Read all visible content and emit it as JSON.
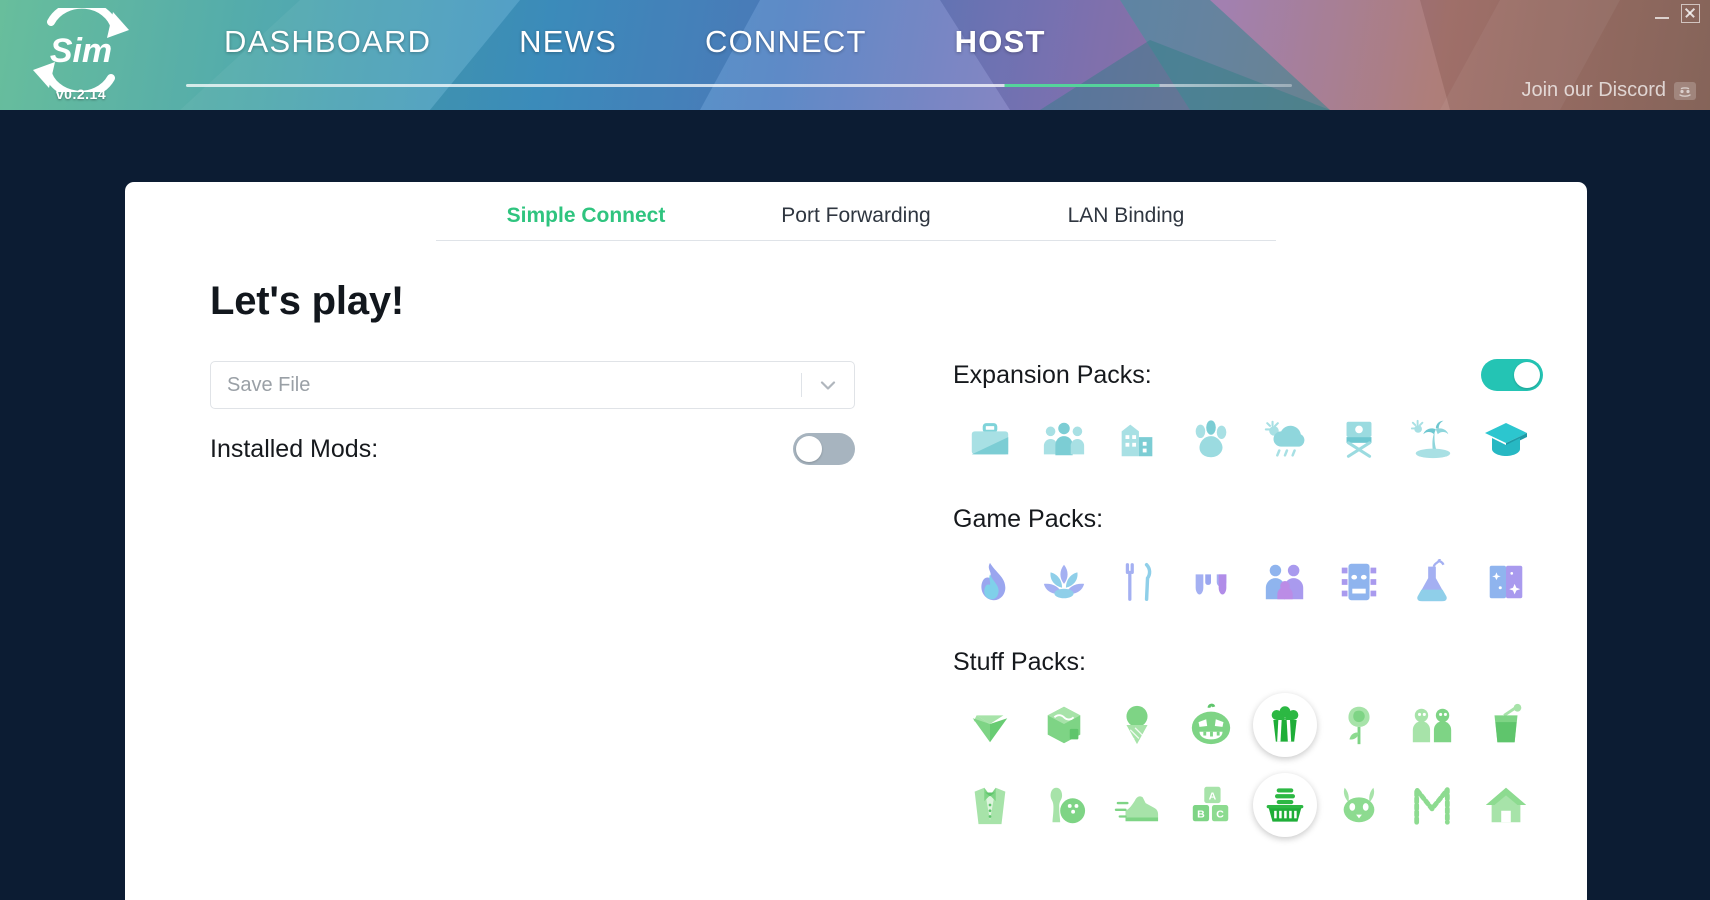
{
  "window": {
    "minimize_label": "minimize",
    "close_label": "close"
  },
  "header": {
    "logo_text": "Sim",
    "version": "v0.2.14",
    "nav": [
      {
        "label": "DASHBOARD",
        "active": false
      },
      {
        "label": "NEWS",
        "active": false
      },
      {
        "label": "CONNECT",
        "active": false
      },
      {
        "label": "HOST",
        "active": true
      }
    ],
    "discord_label": "Join our Discord",
    "accent_green": "#55d39b"
  },
  "tabs": [
    {
      "label": "Simple Connect",
      "active": true
    },
    {
      "label": "Port Forwarding",
      "active": false
    },
    {
      "label": "LAN Binding",
      "active": false
    }
  ],
  "main": {
    "title": "Let's play!",
    "save_file": {
      "placeholder": "Save File",
      "value": ""
    },
    "installed_mods": {
      "label": "Installed Mods:",
      "enabled": false
    }
  },
  "packs": {
    "expansion": {
      "label": "Expansion Packs:",
      "enabled": true,
      "color": "#7fd3d9",
      "items": [
        {
          "name": "briefcase-icon",
          "selected": false
        },
        {
          "name": "people-group-icon",
          "selected": false
        },
        {
          "name": "city-buildings-icon",
          "selected": false
        },
        {
          "name": "paw-print-icon",
          "selected": false
        },
        {
          "name": "weather-sun-cloud-rain-icon",
          "selected": false
        },
        {
          "name": "director-chair-icon",
          "selected": false
        },
        {
          "name": "palm-tree-island-icon",
          "selected": false
        },
        {
          "name": "graduation-cap-icon",
          "selected": true
        }
      ]
    },
    "game": {
      "label": "Game Packs:",
      "color": "#9aa6ef",
      "items": [
        {
          "name": "campfire-icon",
          "selected": false
        },
        {
          "name": "lotus-flower-icon",
          "selected": false
        },
        {
          "name": "fork-knife-icon",
          "selected": false
        },
        {
          "name": "vampire-fangs-icon",
          "selected": false
        },
        {
          "name": "family-parenthood-icon",
          "selected": false
        },
        {
          "name": "jungle-mask-icon",
          "selected": false
        },
        {
          "name": "science-beaker-icon",
          "selected": false
        },
        {
          "name": "magic-book-icon",
          "selected": false
        }
      ]
    },
    "stuff": {
      "label": "Stuff Packs:",
      "color": "#84d98a",
      "items": [
        {
          "name": "diamond-gem-icon",
          "selected": false
        },
        {
          "name": "cupcake-perfect-patio-icon",
          "selected": false
        },
        {
          "name": "ice-cream-cone-icon",
          "selected": false
        },
        {
          "name": "jack-o-lantern-icon",
          "selected": false
        },
        {
          "name": "popcorn-movie-icon",
          "selected": true
        },
        {
          "name": "rose-romantic-icon",
          "selected": false
        },
        {
          "name": "kids-room-icon",
          "selected": false
        },
        {
          "name": "smoothie-drink-icon",
          "selected": false
        },
        {
          "name": "tuxedo-luxury-party-icon",
          "selected": false
        },
        {
          "name": "bowling-pin-ball-icon",
          "selected": false
        },
        {
          "name": "running-shoe-fitness-icon",
          "selected": false
        },
        {
          "name": "abc-blocks-toddler-icon",
          "selected": false
        },
        {
          "name": "laundry-basket-icon",
          "selected": true
        },
        {
          "name": "pet-face-icon",
          "selected": false
        },
        {
          "name": "moschino-m-icon",
          "selected": false
        },
        {
          "name": "tiny-house-icon",
          "selected": false
        }
      ]
    }
  }
}
